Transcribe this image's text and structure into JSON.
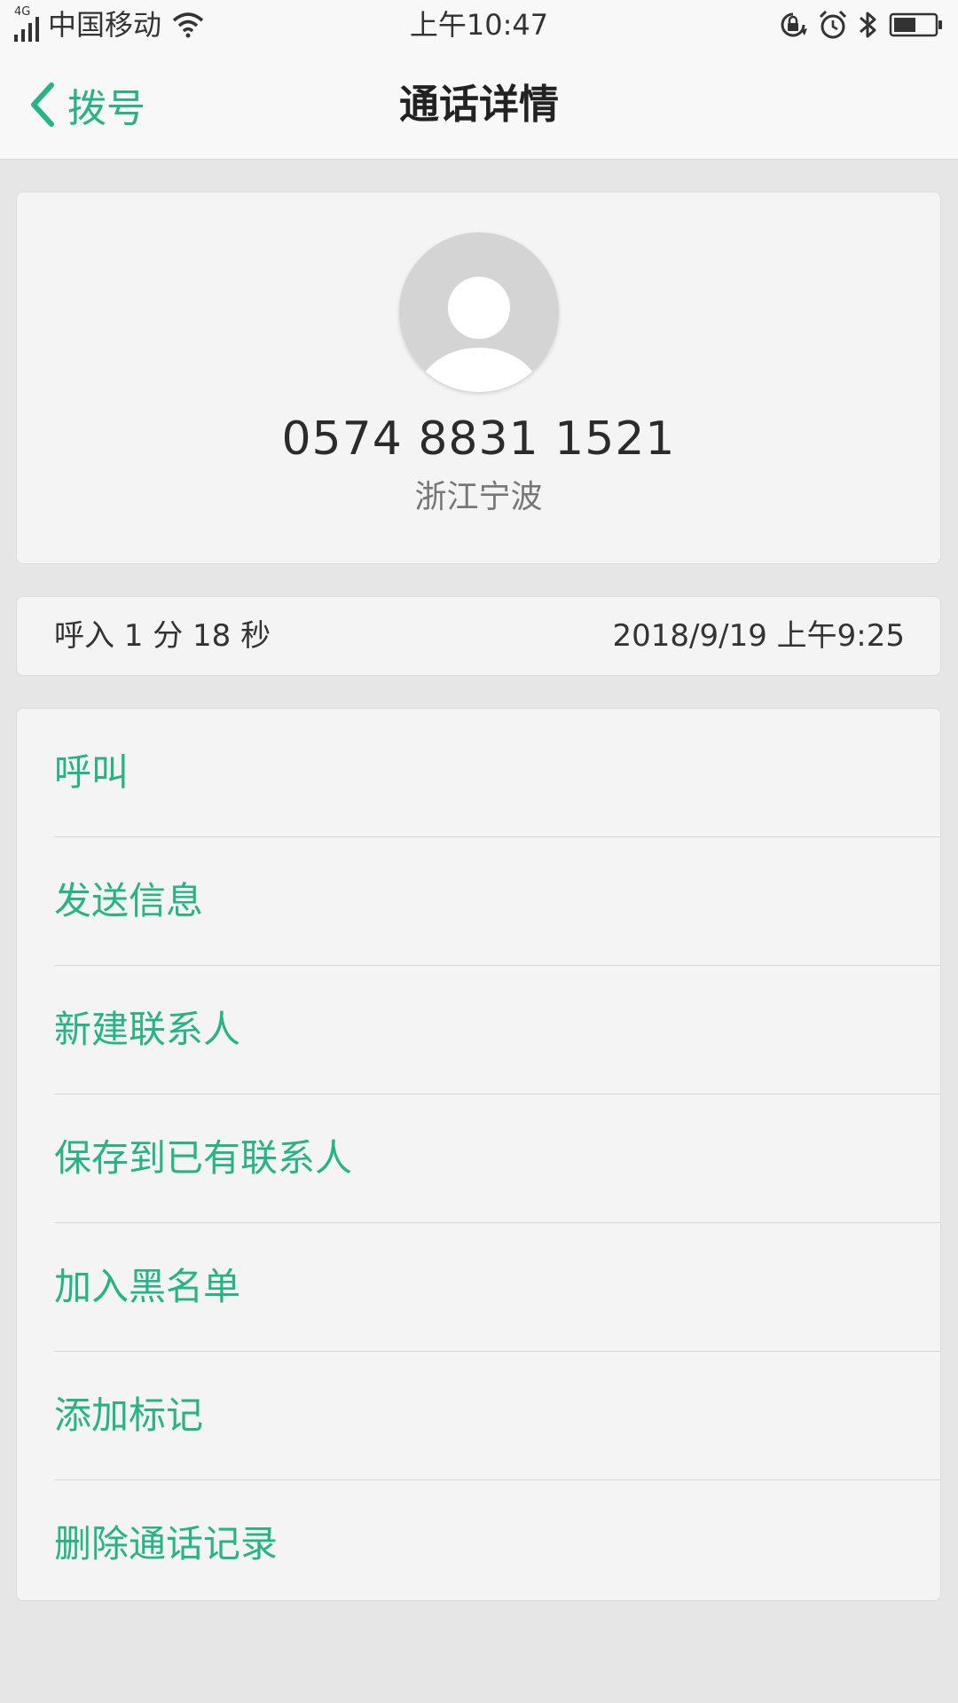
{
  "status_bar": {
    "network_type": "4G",
    "carrier": "中国移动",
    "time": "上午10:47",
    "icons": [
      "signal-icon",
      "wifi-icon",
      "rotation-lock-icon",
      "alarm-icon",
      "bluetooth-icon",
      "battery-icon"
    ],
    "battery_level": 0.55
  },
  "nav": {
    "back_label": "拨号",
    "title": "通话详情"
  },
  "contact": {
    "phone_number": "0574 8831 1521",
    "location": "浙江宁波",
    "avatar_icon": "default-avatar-icon"
  },
  "call_info": {
    "type_duration": "呼入  1 分 18 秒",
    "datetime": "2018/9/19 上午9:25"
  },
  "actions": [
    {
      "label": "呼叫"
    },
    {
      "label": "发送信息"
    },
    {
      "label": "新建联系人"
    },
    {
      "label": "保存到已有联系人"
    },
    {
      "label": "加入黑名单"
    },
    {
      "label": "添加标记"
    },
    {
      "label": "删除通话记录"
    }
  ],
  "colors": {
    "accent": "#27b386",
    "background": "#e6e6e6",
    "card": "#f4f4f4",
    "nav_background": "#f8f8f8"
  }
}
